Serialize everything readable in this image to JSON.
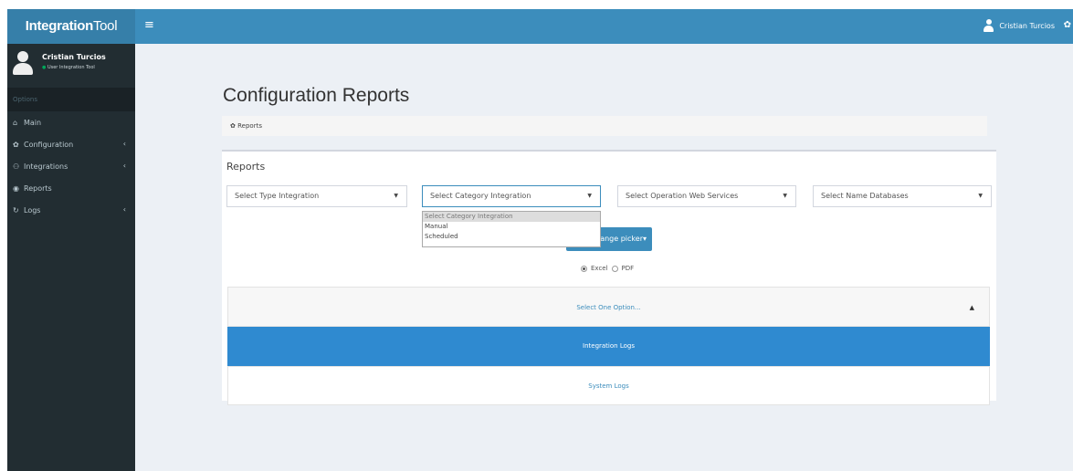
{
  "app": {
    "logo_bold": "Integration",
    "logo_rest": "Tool"
  },
  "topbar": {
    "toggle_glyph": "≡",
    "user_name": "Cristian Turcios"
  },
  "sidebar": {
    "user_name": "Cristian Turcios",
    "user_role": "User Integration Tool",
    "header": "Options",
    "items": [
      {
        "label": "Main",
        "icon": "home-icon",
        "glyph": "⌂",
        "has_children": false
      },
      {
        "label": "Configuration",
        "icon": "gear-icon",
        "glyph": "✿",
        "has_children": true
      },
      {
        "label": "Integrations",
        "icon": "integration-icon",
        "glyph": "⚇",
        "has_children": true
      },
      {
        "label": "Reports",
        "icon": "reports-icon",
        "glyph": "◉",
        "has_children": false
      },
      {
        "label": "Logs",
        "icon": "history-icon",
        "glyph": "↻",
        "has_children": true
      }
    ]
  },
  "page": {
    "title": "Configuration Reports",
    "breadcrumb": "Reports",
    "box_title": "Reports"
  },
  "filters": {
    "type_integration": "Select Type Integration",
    "category_integration": "Select Category Integration",
    "operation_web_services": "Select Operation Web Services",
    "name_databases": "Select Name Databases",
    "category_options": [
      "Select Category Integration",
      "Manual",
      "Scheduled"
    ]
  },
  "range_picker": {
    "label": "range picker▾"
  },
  "format": {
    "excel": "Excel",
    "pdf": "PDF",
    "selected": "Excel"
  },
  "options_list": {
    "header": "Select One Option...",
    "items": [
      "Integration Logs",
      "System Logs"
    ],
    "selected": "Integration Logs"
  },
  "colors": {
    "navbar": "#3c8dbc",
    "logo": "#367fa9",
    "sidebar": "#222d32",
    "accent": "#2f8ad0"
  }
}
